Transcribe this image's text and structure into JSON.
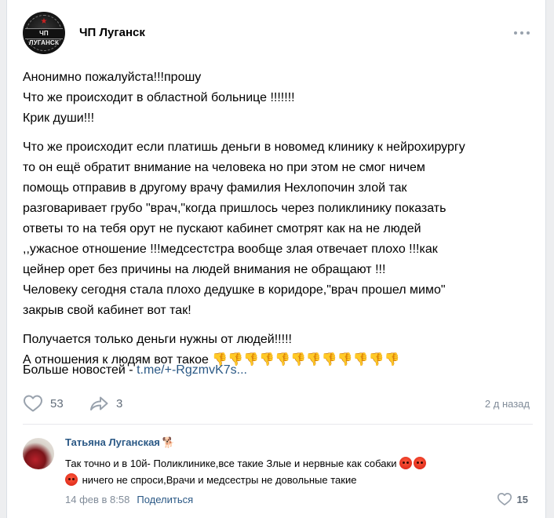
{
  "post": {
    "group_name": "ЧП Луганск",
    "avatar_text": "ЧП ЛУГАНСК",
    "paragraphs": [
      [
        "Анонимно пожалуйста!!!прошу",
        "Что же происходит в областной больнице !!!!!!!",
        "Крик души!!!"
      ],
      [
        "Что же происходит если платишь деньги в новомед клинику к нейрохирургу",
        "то он ещё обратит внимание на человека но при этом не смог ничем",
        "помощь отправив в другому врачу фамилия Нехлопочин злой так",
        "разговаривает грубо \"врач,\"когда пришлось через поликлинику показать",
        "ответы то на тебя орут не пускают кабинет смотрят как на не людей",
        ",,ужасное отношение !!!медсестстра вообще злая отвечает плохо !!!как",
        "цейнер орет без причины на людей внимания не обращают !!!",
        "Человеку сегодня стала плохо дедушке в коридоре,\"врач прошел мимо\"",
        "закрыв свой кабинет вот так!"
      ],
      [
        "Получается только деньги нужны от людей!!!!!"
      ]
    ],
    "last_line_text": "А отношения к людям вот такое ",
    "thumbs_down": "👎👎👎👎👎👎👎👎👎👎👎👎",
    "more_news_prefix": "Больше новостей - ",
    "more_news_link": "t.me/+-RgzmvK7s...",
    "likes": "53",
    "shares": "3",
    "date": "2 д назад"
  },
  "comment": {
    "author": "Татьяна Луганская",
    "author_emoji": "🐕",
    "line1": "Так точно и в 10й- Поликлинике,все такие Злые и нервные как собаки ",
    "line2": " ничего не спроси,Врачи и медсестры не довольные такие",
    "date": "14 фев в 8:58",
    "share_label": "Поделиться",
    "likes": "15"
  },
  "icons": {
    "more": "more-horizontal-icon",
    "like": "heart-outline-icon",
    "share": "share-arrow-icon",
    "reaction": "angry-face-emoji"
  },
  "colors": {
    "link": "#2a5885",
    "secondary": "#818c99",
    "background": "#edeef0"
  }
}
